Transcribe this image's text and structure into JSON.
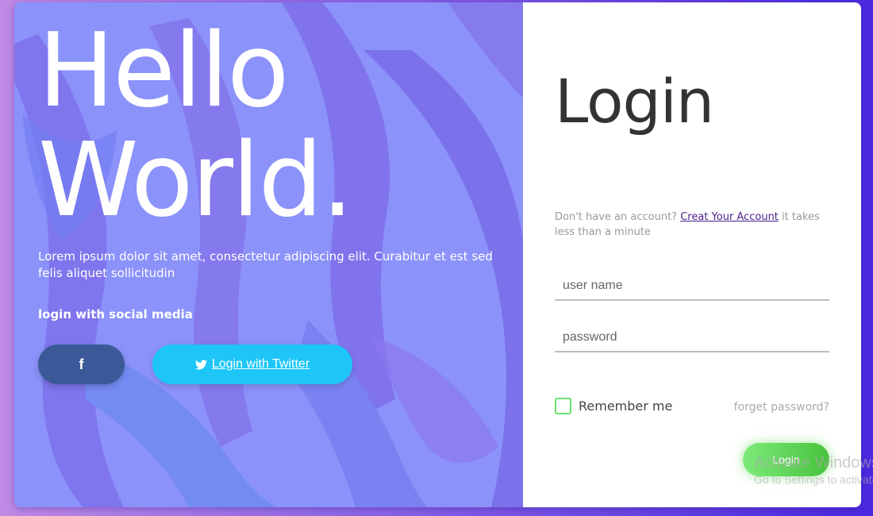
{
  "hero": {
    "heading_line1": "Hello",
    "heading_line2": "World.",
    "description": "Lorem ipsum dolor sit amet, consectetur adipiscing elit. Curabitur et est sed felis aliquet sollicitudin",
    "social_title": "login with social media",
    "facebook_icon": "f",
    "twitter_button_label": " Login with Twitter"
  },
  "login": {
    "title": "Login",
    "signup_prefix": "Don't have an account? ",
    "signup_link": "Creat Your Account",
    "signup_suffix": " it takes less than a minute",
    "username_placeholder": "user name",
    "password_placeholder": "password",
    "remember_label": "Remember me",
    "forget_link": "forget password?",
    "login_button": "Login"
  },
  "watermark": {
    "line1": "Activate Windows",
    "line2": "Go to Settings to activate Windows."
  },
  "colors": {
    "facebook": "#3b5998",
    "twitter": "#1dc6f7",
    "login_button": "#4cc441",
    "hero_overlay": "#8086fa"
  }
}
